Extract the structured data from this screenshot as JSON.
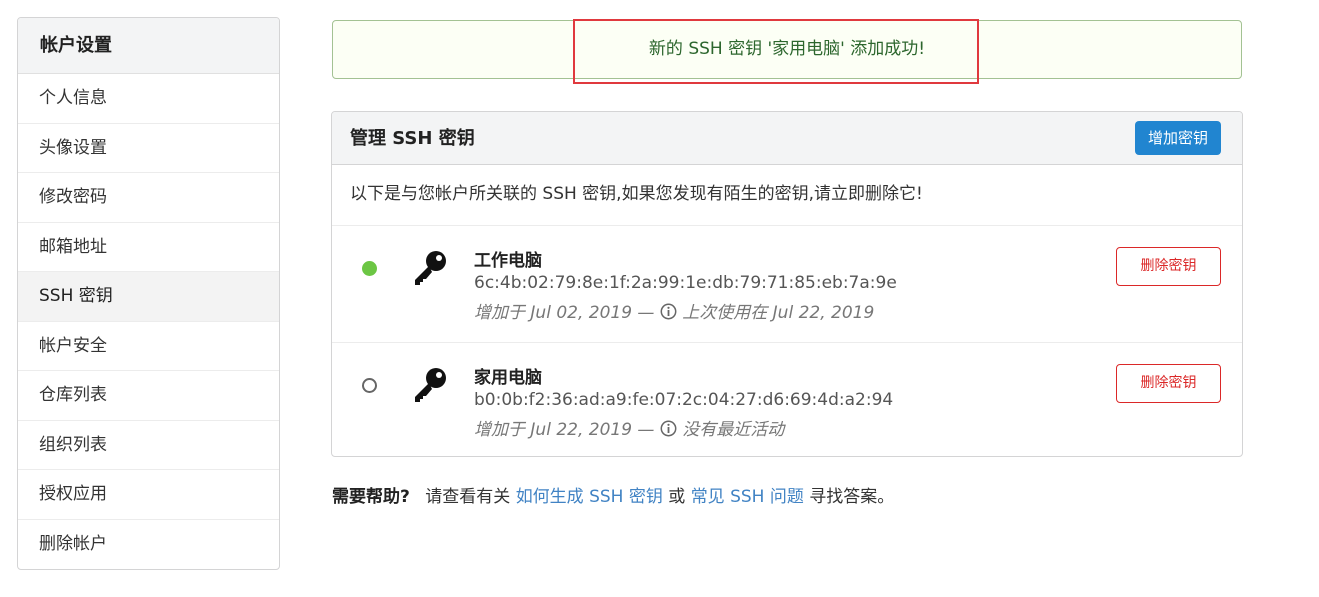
{
  "sidebar": {
    "title": "帐户设置",
    "items": [
      {
        "label": "个人信息"
      },
      {
        "label": "头像设置"
      },
      {
        "label": "修改密码"
      },
      {
        "label": "邮箱地址"
      },
      {
        "label": "SSH 密钥",
        "active": true
      },
      {
        "label": "帐户安全"
      },
      {
        "label": "仓库列表"
      },
      {
        "label": "组织列表"
      },
      {
        "label": "授权应用"
      },
      {
        "label": "删除帐户"
      }
    ]
  },
  "flash": {
    "message": "新的 SSH 密钥 '家用电脑' 添加成功!"
  },
  "panel": {
    "title": "管理 SSH 密钥",
    "add_button": "增加密钥",
    "description": "以下是与您帐户所关联的 SSH 密钥,如果您发现有陌生的密钥,请立即删除它!",
    "keys": [
      {
        "name": "工作电脑",
        "fingerprint": "6c:4b:02:79:8e:1f:2a:99:1e:db:79:71:85:eb:7a:9e",
        "added": "增加于 Jul 02, 2019 —",
        "last_used": "上次使用在 Jul 22, 2019",
        "status": "active",
        "delete_label": "删除密钥"
      },
      {
        "name": "家用电脑",
        "fingerprint": "b0:0b:f2:36:ad:a9:fe:07:2c:04:27:d6:69:4d:a2:94",
        "added": "增加于 Jul 22, 2019 —",
        "last_used": "没有最近活动",
        "status": "inactive",
        "delete_label": "删除密钥"
      }
    ]
  },
  "help": {
    "label": "需要帮助?",
    "text1": "请查看有关",
    "link1": "如何生成 SSH 密钥",
    "text2": "或",
    "link2": "常见 SSH 问题",
    "text3": "寻找答案。"
  },
  "colors": {
    "primary": "#2185d0",
    "danger": "#db2828",
    "success_text": "#2c662d",
    "success_bg": "#fcfff5",
    "active_dot": "#6cc644",
    "link": "#4183c4"
  }
}
